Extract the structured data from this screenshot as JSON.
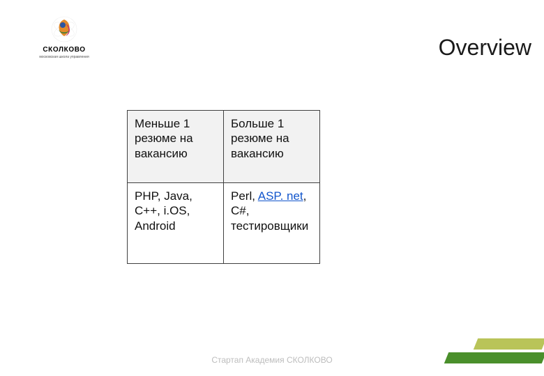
{
  "logo": {
    "text": "СКОЛКОВО",
    "subtitle": "московская школа управления"
  },
  "title": "Overview",
  "table": {
    "header": {
      "col1": "Меньше 1 резюме на вакансию",
      "col2": "Больше 1 резюме на вакансию"
    },
    "body": {
      "col1": "PHP, Java, C++, i.OS, Android",
      "col2_prefix": "Perl, ",
      "col2_link": "ASP. net",
      "col2_suffix": ", C#, тестировщики"
    }
  },
  "footer": "Стартап Академия СКОЛКОВО",
  "colors": {
    "bar_light": "#b9c459",
    "bar_dark": "#4a8f2b"
  }
}
